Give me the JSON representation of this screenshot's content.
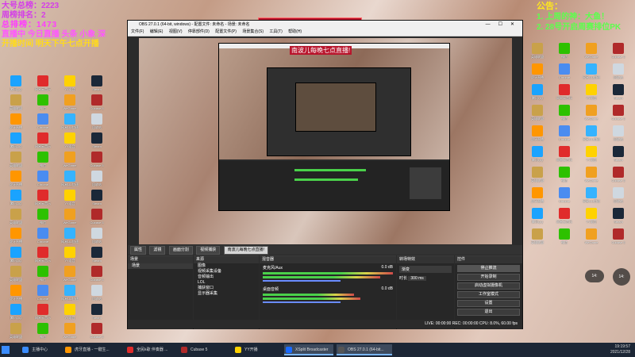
{
  "overlay_left": {
    "line1": "大号总榜：2223",
    "line2": "周榜排名：2",
    "line3": "总排榜：1473",
    "line4": "直播中 今日直播 头条 小象 深",
    "line5": "开播时间 明天下午七点开播"
  },
  "overlay_right": {
    "title": "公告：",
    "line1": "1. 上周的神：大鱼！",
    "line2": "2. 28号开启周赛排位PK"
  },
  "banner": "南波儿每晚七点直播!",
  "obs": {
    "title": "OBS 27.0.1 (64-bit, windows) - 配置文件: 未命名 - 场景: 未命名",
    "menu": [
      "文件(F)",
      "编辑(E)",
      "视图(V)",
      "停靠部件(D)",
      "配置文件(P)",
      "场景集合(S)",
      "工具(T)",
      "帮助(H)"
    ],
    "source_bar": {
      "label1": "属性",
      "label2": "滤镜",
      "btn1": "画面分割",
      "btn2": "视频捕获",
      "btn3": "南波儿每晚七点直播!"
    },
    "docks": {
      "scenes": "场景",
      "sources": "来源",
      "mixer": "混音器",
      "transitions": "转场特效",
      "controls": "控件"
    },
    "scenes_list": [
      "场景"
    ],
    "sources_list": [
      "图像",
      "视频采集设备",
      "音频输出",
      "LOL",
      "捕获窗口",
      "显示器采集"
    ],
    "mixer": {
      "ch1": "麦克风/Aux",
      "ch2": "桌面音频",
      "db1": "0.0 dB",
      "db2": "0.0 dB"
    },
    "transitions": {
      "fade": "渐变",
      "duration_label": "时长",
      "duration": "300 ms"
    },
    "controls": [
      "停止推流",
      "开始录制",
      "启动虚拟摄像机",
      "工作室模式",
      "设置",
      "退出"
    ],
    "status": "LIVE: 00:00:00   REC: 00:00:00   CPU: 8.0%, 60.00 fps"
  },
  "desktop_icons": [
    {
      "label": "腾讯QQ",
      "color": "#1aa3ff"
    },
    {
      "label": "网易云音乐",
      "color": "#e02b2b"
    },
    {
      "label": "YY语音",
      "color": "#ffd200"
    },
    {
      "label": "Steam",
      "color": "#1b2838"
    },
    {
      "label": "英雄联盟",
      "color": "#c9a14a"
    },
    {
      "label": "微信",
      "color": "#2dc100"
    },
    {
      "label": "WeGame",
      "color": "#f0a020"
    },
    {
      "label": "Cubase 5",
      "color": "#b02a2a"
    },
    {
      "label": "虎牙直播",
      "color": "#ff9600"
    },
    {
      "label": "Chrome",
      "color": "#4a8cf0"
    },
    {
      "label": "网易UU加速",
      "color": "#35b3ff"
    },
    {
      "label": "回收站",
      "color": "#cfd8e0"
    }
  ],
  "taskbar": {
    "items": [
      "主播中心",
      "虎牙直播 - 一键生...",
      "全民k歌 伴奏器 ...",
      "Cubase 5",
      "YY开播",
      "XSplit Broadcaster",
      "OBS 27.0.1 (64-bit..."
    ],
    "time": "19:19:57",
    "date": "2021/12/28"
  },
  "floaty_left": "14:",
  "floaty_right": "14:"
}
